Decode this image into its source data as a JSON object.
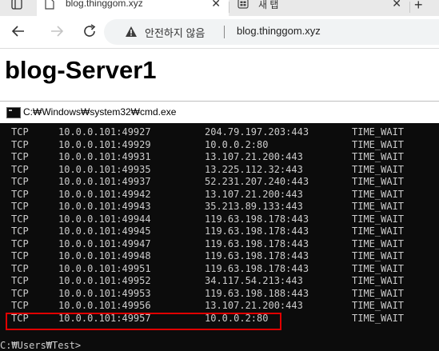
{
  "browser": {
    "tabs": [
      {
        "title": "blog.thinggom.xyz",
        "active": true
      },
      {
        "title": "새 탭",
        "active": false
      }
    ],
    "security_warning": "안전하지 않음",
    "url": "blog.thinggom.xyz",
    "icons": [
      "tab-actions-icon",
      "page-favicon-icon",
      "close-icon",
      "new-tab-icon",
      "back-icon",
      "forward-icon",
      "reload-icon",
      "warning-icon"
    ]
  },
  "page": {
    "title": "blog-Server1"
  },
  "cmd": {
    "window_title": "C:₩Windows₩system32₩cmd.exe",
    "connections": [
      {
        "proto": "TCP",
        "local": "10.0.0.101:49927",
        "foreign": "204.79.197.203:443",
        "state": "TIME_WAIT"
      },
      {
        "proto": "TCP",
        "local": "10.0.0.101:49929",
        "foreign": "10.0.0.2:80",
        "state": "TIME_WAIT"
      },
      {
        "proto": "TCP",
        "local": "10.0.0.101:49931",
        "foreign": "13.107.21.200:443",
        "state": "TIME_WAIT"
      },
      {
        "proto": "TCP",
        "local": "10.0.0.101:49935",
        "foreign": "13.225.112.32:443",
        "state": "TIME_WAIT"
      },
      {
        "proto": "TCP",
        "local": "10.0.0.101:49937",
        "foreign": "52.231.207.240:443",
        "state": "TIME_WAIT"
      },
      {
        "proto": "TCP",
        "local": "10.0.0.101:49942",
        "foreign": "13.107.21.200:443",
        "state": "TIME_WAIT"
      },
      {
        "proto": "TCP",
        "local": "10.0.0.101:49943",
        "foreign": "35.213.89.133:443",
        "state": "TIME_WAIT"
      },
      {
        "proto": "TCP",
        "local": "10.0.0.101:49944",
        "foreign": "119.63.198.178:443",
        "state": "TIME_WAIT"
      },
      {
        "proto": "TCP",
        "local": "10.0.0.101:49945",
        "foreign": "119.63.198.178:443",
        "state": "TIME_WAIT"
      },
      {
        "proto": "TCP",
        "local": "10.0.0.101:49947",
        "foreign": "119.63.198.178:443",
        "state": "TIME_WAIT"
      },
      {
        "proto": "TCP",
        "local": "10.0.0.101:49948",
        "foreign": "119.63.198.178:443",
        "state": "TIME_WAIT"
      },
      {
        "proto": "TCP",
        "local": "10.0.0.101:49951",
        "foreign": "119.63.198.178:443",
        "state": "TIME_WAIT"
      },
      {
        "proto": "TCP",
        "local": "10.0.0.101:49952",
        "foreign": "34.117.54.213:443",
        "state": "TIME_WAIT"
      },
      {
        "proto": "TCP",
        "local": "10.0.0.101:49953",
        "foreign": "119.63.198.188:443",
        "state": "TIME_WAIT"
      },
      {
        "proto": "TCP",
        "local": "10.0.0.101:49956",
        "foreign": "13.107.21.200:443",
        "state": "TIME_WAIT"
      },
      {
        "proto": "TCP",
        "local": "10.0.0.101:49957",
        "foreign": "10.0.0.2:80",
        "state": "TIME_WAIT",
        "highlighted": true
      }
    ],
    "prompt": "C:₩Users₩Test>",
    "colors": {
      "background": "#0c0c0c",
      "text": "#cccccc",
      "highlight_border": "#e00000"
    }
  }
}
